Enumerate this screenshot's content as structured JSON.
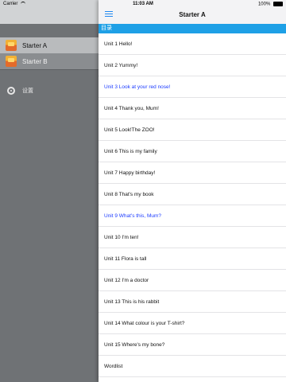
{
  "status_bar": {
    "carrier": "Carrier",
    "time": "11:03 AM",
    "battery": "100%"
  },
  "sidebar": {
    "items": [
      {
        "label": "Starter A",
        "icon": "book-cover-icon",
        "state": "active"
      },
      {
        "label": "Starter B",
        "icon": "book-cover-icon",
        "state": "inactive"
      }
    ],
    "settings": {
      "label": "设置",
      "icon": "gear-icon"
    }
  },
  "main": {
    "title": "Starter A",
    "menu_icon": "hamburger-menu-icon",
    "section_header": "目录",
    "units": [
      {
        "label": "Unit 1 Hello!",
        "highlight": false
      },
      {
        "label": "Unit 2 Yummy!",
        "highlight": false
      },
      {
        "label": "Unit 3 Look at your red nose!",
        "highlight": true
      },
      {
        "label": "Unit 4 Thank you,  Mum!",
        "highlight": false
      },
      {
        "label": "Unit 5 Look!The ZOO!",
        "highlight": false
      },
      {
        "label": "Unit 6 This is my family",
        "highlight": false
      },
      {
        "label": "Unit 7 Happy birthday!",
        "highlight": false
      },
      {
        "label": "Unit 8 That's my book",
        "highlight": false
      },
      {
        "label": "Unit 9 What's this,  Mum?",
        "highlight": true
      },
      {
        "label": "Unit 10 I'm ten!",
        "highlight": false
      },
      {
        "label": "Unit 11 Flora is tall",
        "highlight": false
      },
      {
        "label": "Unit 12 I'm a doctor",
        "highlight": false
      },
      {
        "label": "Unit 13 This is his rabbit",
        "highlight": false
      },
      {
        "label": "Unit 14 What colour is your T-shirt?",
        "highlight": false
      },
      {
        "label": "Unit 15 Where's my bone?",
        "highlight": false
      },
      {
        "label": "Wordlist",
        "highlight": false
      }
    ]
  },
  "colors": {
    "accent_blue": "#1ea0e6",
    "highlight_text": "#1c3cff",
    "sidebar_bg": "#6f7275"
  }
}
